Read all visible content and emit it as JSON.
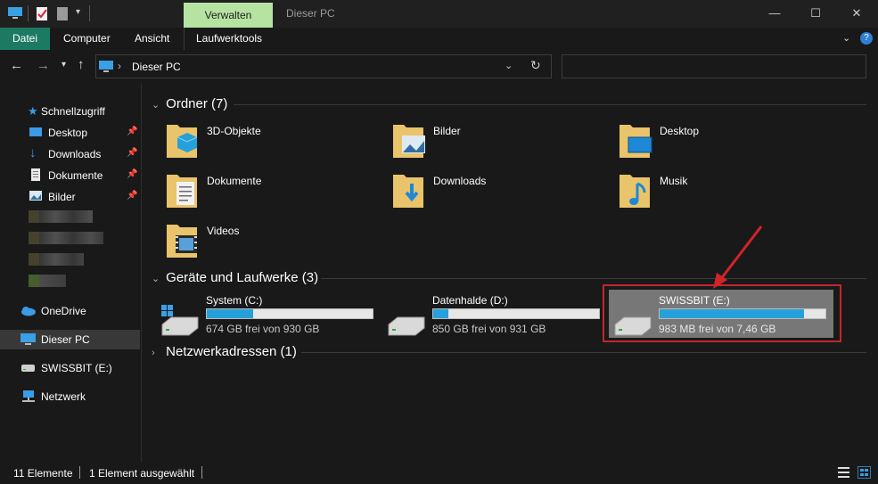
{
  "titlebar": {
    "manage_tab": "Verwalten",
    "window_title": "Dieser PC",
    "minimize": "—",
    "maximize": "☐",
    "close": "✕"
  },
  "ribbon": {
    "tabs": [
      "Datei",
      "Computer",
      "Ansicht",
      "Laufwerktools"
    ]
  },
  "nav": {
    "address": "Dieser PC",
    "search_placeholder": ""
  },
  "sidebar": {
    "quick_access": "Schnellzugriff",
    "pinned": [
      {
        "label": "Desktop",
        "icon": "desktop-icon"
      },
      {
        "label": "Downloads",
        "icon": "downloads-icon"
      },
      {
        "label": "Dokumente",
        "icon": "documents-icon"
      },
      {
        "label": "Bilder",
        "icon": "pictures-icon"
      }
    ],
    "onedrive": "OneDrive",
    "this_pc": "Dieser PC",
    "usb": "SWISSBIT (E:)",
    "network": "Netzwerk"
  },
  "groups": {
    "folders": "Ordner (7)",
    "drives": "Geräte und Laufwerke (3)",
    "network": "Netzwerkadressen (1)"
  },
  "folders": [
    {
      "label": "3D-Objekte",
      "icon": "3d-objects-folder-icon"
    },
    {
      "label": "Bilder",
      "icon": "pictures-folder-icon"
    },
    {
      "label": "Desktop",
      "icon": "desktop-folder-icon"
    },
    {
      "label": "Dokumente",
      "icon": "documents-folder-icon"
    },
    {
      "label": "Downloads",
      "icon": "downloads-folder-icon"
    },
    {
      "label": "Musik",
      "icon": "music-folder-icon"
    },
    {
      "label": "Videos",
      "icon": "videos-folder-icon"
    }
  ],
  "drives": [
    {
      "name": "System (C:)",
      "free": "674 GB frei von 930 GB",
      "used_fraction": 0.28
    },
    {
      "name": "Datenhalde (D:)",
      "free": "850 GB frei von 931 GB",
      "used_fraction": 0.09
    },
    {
      "name": "SWISSBIT (E:)",
      "free": "983 MB frei von 7,46 GB",
      "used_fraction": 0.87
    }
  ],
  "status": {
    "count": "11 Elemente",
    "selection": "1 Element ausgewählt"
  },
  "colors": {
    "accent": "#1d7a62",
    "manage_tab": "#b6e3a2",
    "drive_fill": "#26a0da",
    "highlight": "#c1272d"
  }
}
